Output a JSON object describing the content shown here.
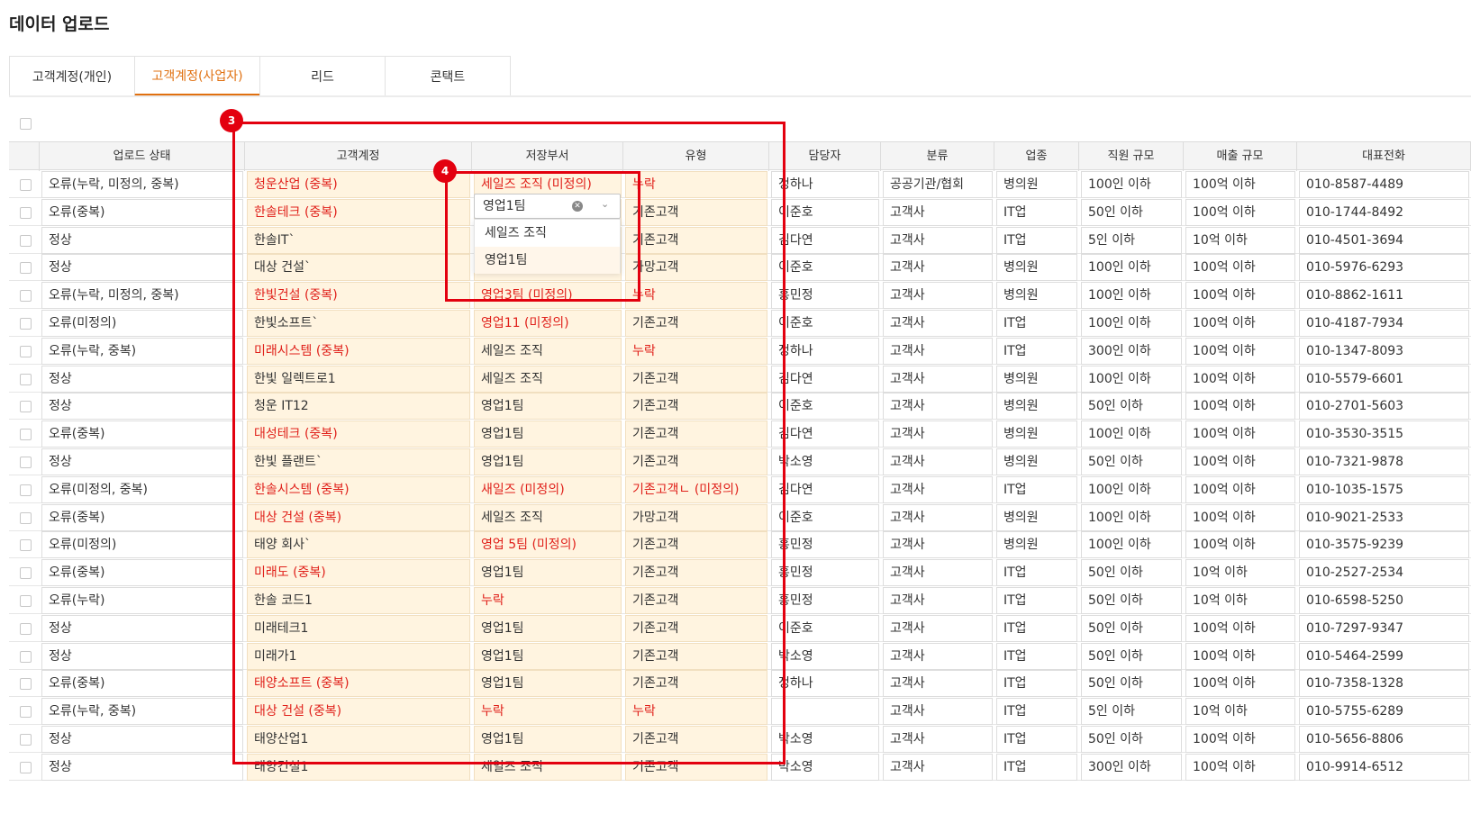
{
  "page": {
    "title": "데이터 업로드"
  },
  "tabs": [
    {
      "label": "고객계정(개인)",
      "active": false
    },
    {
      "label": "고객계정(사업자)",
      "active": true
    },
    {
      "label": "리드",
      "active": false
    },
    {
      "label": "콘택트",
      "active": false
    }
  ],
  "columns": [
    "업로드 상태",
    "고객계정",
    "저장부서",
    "유형",
    "담당자",
    "분류",
    "업종",
    "직원 규모",
    "매출 규모",
    "대표전화"
  ],
  "rows": [
    {
      "status": "오류(누락, 미정의, 중복)",
      "account": "청운산업 (중복)",
      "account_err": true,
      "dept": "세일즈 조직 (미정의)",
      "dept_err": true,
      "type": "누락",
      "type_err": true,
      "owner": "정하나",
      "cat": "공공기관/협회",
      "industry": "병의원",
      "emp": "100인 이하",
      "rev": "100억 이하",
      "phone": "010-8587-4489"
    },
    {
      "status": "오류(중복)",
      "account": "한솔테크 (중복)",
      "account_err": true,
      "dept": "",
      "dept_err": false,
      "type": "기존고객",
      "type_err": false,
      "owner": "이준호",
      "cat": "고객사",
      "industry": "IT업",
      "emp": "50인 이하",
      "rev": "100억 이하",
      "phone": "010-1744-8492"
    },
    {
      "status": "정상",
      "account": "한솔IT`",
      "account_err": false,
      "dept": "",
      "dept_err": false,
      "type": "기존고객",
      "type_err": false,
      "owner": "김다연",
      "cat": "고객사",
      "industry": "IT업",
      "emp": "5인 이하",
      "rev": "10억 이하",
      "phone": "010-4501-3694"
    },
    {
      "status": "정상",
      "account": "대상 건설`",
      "account_err": false,
      "dept": "",
      "dept_err": false,
      "type": "가망고객",
      "type_err": false,
      "owner": "이준호",
      "cat": "고객사",
      "industry": "병의원",
      "emp": "100인 이하",
      "rev": "100억 이하",
      "phone": "010-5976-6293"
    },
    {
      "status": "오류(누락, 미정의, 중복)",
      "account": "한빛건설 (중복)",
      "account_err": true,
      "dept": "영업3팀 (미정의)",
      "dept_err": true,
      "type": "누락",
      "type_err": true,
      "owner": "홍민정",
      "cat": "고객사",
      "industry": "병의원",
      "emp": "100인 이하",
      "rev": "100억 이하",
      "phone": "010-8862-1611"
    },
    {
      "status": "오류(미정의)",
      "account": "한빛소프트`",
      "account_err": false,
      "dept": "영업11 (미정의)",
      "dept_err": true,
      "type": "기존고객",
      "type_err": false,
      "owner": "이준호",
      "cat": "고객사",
      "industry": "IT업",
      "emp": "100인 이하",
      "rev": "100억 이하",
      "phone": "010-4187-7934"
    },
    {
      "status": "오류(누락, 중복)",
      "account": "미래시스템 (중복)",
      "account_err": true,
      "dept": "세일즈 조직",
      "dept_err": false,
      "type": "누락",
      "type_err": true,
      "owner": "정하나",
      "cat": "고객사",
      "industry": "IT업",
      "emp": "300인 이하",
      "rev": "100억 이하",
      "phone": "010-1347-8093"
    },
    {
      "status": "정상",
      "account": "한빛 일렉트로1",
      "account_err": false,
      "dept": "세일즈 조직",
      "dept_err": false,
      "type": "기존고객",
      "type_err": false,
      "owner": "김다연",
      "cat": "고객사",
      "industry": "병의원",
      "emp": "100인 이하",
      "rev": "100억 이하",
      "phone": "010-5579-6601"
    },
    {
      "status": "정상",
      "account": "청운 IT12",
      "account_err": false,
      "dept": "영업1팀",
      "dept_err": false,
      "type": "기존고객",
      "type_err": false,
      "owner": "이준호",
      "cat": "고객사",
      "industry": "병의원",
      "emp": "50인 이하",
      "rev": "100억 이하",
      "phone": "010-2701-5603"
    },
    {
      "status": "오류(중복)",
      "account": "대성테크 (중복)",
      "account_err": true,
      "dept": "영업1팀",
      "dept_err": false,
      "type": "기존고객",
      "type_err": false,
      "owner": "김다연",
      "cat": "고객사",
      "industry": "병의원",
      "emp": "100인 이하",
      "rev": "100억 이하",
      "phone": "010-3530-3515"
    },
    {
      "status": "정상",
      "account": "한빛 플랜트`",
      "account_err": false,
      "dept": "영업1팀",
      "dept_err": false,
      "type": "기존고객",
      "type_err": false,
      "owner": "박소영",
      "cat": "고객사",
      "industry": "병의원",
      "emp": "50인 이하",
      "rev": "100억 이하",
      "phone": "010-7321-9878"
    },
    {
      "status": "오류(미정의, 중복)",
      "account": "한솔시스템 (중복)",
      "account_err": true,
      "dept": "새일즈 (미정의)",
      "dept_err": true,
      "type": "기존고객ㄴ (미정의)",
      "type_err": true,
      "owner": "김다연",
      "cat": "고객사",
      "industry": "IT업",
      "emp": "100인 이하",
      "rev": "100억 이하",
      "phone": "010-1035-1575"
    },
    {
      "status": "오류(중복)",
      "account": "대상 건설 (중복)",
      "account_err": true,
      "dept": "세일즈 조직",
      "dept_err": false,
      "type": "가망고객",
      "type_err": false,
      "owner": "이준호",
      "cat": "고객사",
      "industry": "병의원",
      "emp": "100인 이하",
      "rev": "100억 이하",
      "phone": "010-9021-2533"
    },
    {
      "status": "오류(미정의)",
      "account": "태양 회사`",
      "account_err": false,
      "dept": "영업 5팀 (미정의)",
      "dept_err": true,
      "type": "기존고객",
      "type_err": false,
      "owner": "홍민정",
      "cat": "고객사",
      "industry": "병의원",
      "emp": "100인 이하",
      "rev": "100억 이하",
      "phone": "010-3575-9239"
    },
    {
      "status": "오류(중복)",
      "account": "미래도 (중복)",
      "account_err": true,
      "dept": "영업1팀",
      "dept_err": false,
      "type": "기존고객",
      "type_err": false,
      "owner": "홍민정",
      "cat": "고객사",
      "industry": "IT업",
      "emp": "50인 이하",
      "rev": "10억 이하",
      "phone": "010-2527-2534"
    },
    {
      "status": "오류(누락)",
      "account": "한솔 코드1",
      "account_err": false,
      "dept": "누락",
      "dept_err": true,
      "type": "기존고객",
      "type_err": false,
      "owner": "홍민정",
      "cat": "고객사",
      "industry": "IT업",
      "emp": "50인 이하",
      "rev": "10억 이하",
      "phone": "010-6598-5250"
    },
    {
      "status": "정상",
      "account": "미래테크1",
      "account_err": false,
      "dept": "영업1팀",
      "dept_err": false,
      "type": "기존고객",
      "type_err": false,
      "owner": "이준호",
      "cat": "고객사",
      "industry": "IT업",
      "emp": "50인 이하",
      "rev": "100억 이하",
      "phone": "010-7297-9347"
    },
    {
      "status": "정상",
      "account": "미래가1",
      "account_err": false,
      "dept": "영업1팀",
      "dept_err": false,
      "type": "기존고객",
      "type_err": false,
      "owner": "박소영",
      "cat": "고객사",
      "industry": "IT업",
      "emp": "50인 이하",
      "rev": "100억 이하",
      "phone": "010-5464-2599"
    },
    {
      "status": "오류(중복)",
      "account": "태양소프트 (중복)",
      "account_err": true,
      "dept": "영업1팀",
      "dept_err": false,
      "type": "기존고객",
      "type_err": false,
      "owner": "정하나",
      "cat": "고객사",
      "industry": "IT업",
      "emp": "50인 이하",
      "rev": "100억 이하",
      "phone": "010-7358-1328"
    },
    {
      "status": "오류(누락, 중복)",
      "account": "대상 건설 (중복)",
      "account_err": true,
      "dept": "누락",
      "dept_err": true,
      "type": "누락",
      "type_err": true,
      "owner": "",
      "cat": "고객사",
      "industry": "IT업",
      "emp": "5인 이하",
      "rev": "10억 이하",
      "phone": "010-5755-6289"
    },
    {
      "status": "정상",
      "account": "태양산업1",
      "account_err": false,
      "dept": "영업1팀",
      "dept_err": false,
      "type": "기존고객",
      "type_err": false,
      "owner": "박소영",
      "cat": "고객사",
      "industry": "IT업",
      "emp": "50인 이하",
      "rev": "100억 이하",
      "phone": "010-5656-8806"
    },
    {
      "status": "정상",
      "account": "태양건설1",
      "account_err": false,
      "dept": "세일즈 조직",
      "dept_err": false,
      "type": "기존고객",
      "type_err": false,
      "owner": "박소영",
      "cat": "고객사",
      "industry": "IT업",
      "emp": "300인 이하",
      "rev": "100억 이하",
      "phone": "010-9914-6512"
    }
  ],
  "dropdown": {
    "value": "영업1팀",
    "options": [
      "세일즈 조직",
      "영업1팀"
    ],
    "selected_index": 1
  },
  "annotations": [
    {
      "badge": "3",
      "color": "#e3000f"
    },
    {
      "badge": "4",
      "color": "#e3000f"
    }
  ],
  "colors": {
    "accent": "#e07010",
    "error": "#e0201a",
    "editable_bg": "#fff4e0",
    "annotation": "#e3000f"
  }
}
